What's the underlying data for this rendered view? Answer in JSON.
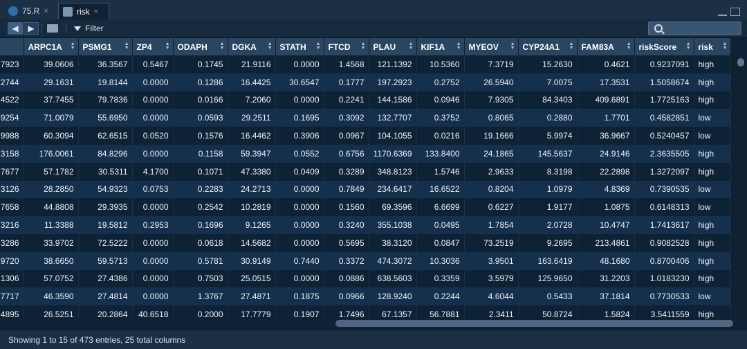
{
  "tabs": [
    {
      "label": "75.R",
      "close": "×"
    },
    {
      "label": "risk",
      "close": "×"
    }
  ],
  "toolbar": {
    "filter_label": "Filter"
  },
  "table": {
    "columns": [
      "",
      "ARPC1A",
      "PSMG1",
      "ZP4",
      "ODAPH",
      "DGKA",
      "STATH",
      "FTCD",
      "PLAU",
      "KIF1A",
      "MYEOV",
      "CYP24A1",
      "FAM83A",
      "riskScore",
      "risk"
    ],
    "rows": [
      [
        "7923",
        "39.0606",
        "36.3567",
        "0.5467",
        "0.1745",
        "21.9116",
        "0.0000",
        "1.4568",
        "121.1392",
        "10.5360",
        "7.3719",
        "15.2630",
        "0.4621",
        "0.9237091",
        "high"
      ],
      [
        "2744",
        "29.1631",
        "19.8144",
        "0.0000",
        "0.1286",
        "16.4425",
        "30.6547",
        "0.1777",
        "197.2923",
        "0.2752",
        "26.5940",
        "7.0075",
        "17.3531",
        "1.5058674",
        "high"
      ],
      [
        "4522",
        "37.7455",
        "79.7836",
        "0.0000",
        "0.0166",
        "7.2060",
        "0.0000",
        "0.2241",
        "144.1586",
        "0.0946",
        "7.9305",
        "84.3403",
        "409.6891",
        "1.7725163",
        "high"
      ],
      [
        "9254",
        "71.0079",
        "55.6950",
        "0.0000",
        "0.0593",
        "29.2511",
        "0.1695",
        "0.3092",
        "132.7707",
        "0.3752",
        "0.8065",
        "0.2880",
        "1.7701",
        "0.4582851",
        "low"
      ],
      [
        "9988",
        "60.3094",
        "62.6515",
        "0.0520",
        "0.1576",
        "16.4462",
        "0.3906",
        "0.0967",
        "104.1055",
        "0.0216",
        "19.1666",
        "5.9974",
        "36.9667",
        "0.5240457",
        "low"
      ],
      [
        "3158",
        "176.0061",
        "84.8296",
        "0.0000",
        "0.1158",
        "59.3947",
        "0.0552",
        "0.6756",
        "1170.6369",
        "133.8400",
        "24.1865",
        "145.5637",
        "24.9146",
        "2.3635505",
        "high"
      ],
      [
        "7677",
        "57.1782",
        "30.5311",
        "4.1700",
        "0.1071",
        "47.3380",
        "0.0409",
        "0.3289",
        "348.8123",
        "1.5746",
        "2.9633",
        "8.3198",
        "22.2898",
        "1.3272097",
        "high"
      ],
      [
        "3126",
        "28.2850",
        "54.9323",
        "0.0753",
        "0.2283",
        "24.2713",
        "0.0000",
        "0.7849",
        "234.6417",
        "16.6522",
        "0.8204",
        "1.0979",
        "4.8369",
        "0.7390535",
        "low"
      ],
      [
        "7658",
        "44.8808",
        "29.3935",
        "0.0000",
        "0.2542",
        "10.2819",
        "0.0000",
        "0.1560",
        "69.3596",
        "6.6699",
        "0.6227",
        "1.9177",
        "1.0875",
        "0.6148313",
        "low"
      ],
      [
        "3216",
        "11.3388",
        "19.5812",
        "0.2953",
        "0.1696",
        "9.1265",
        "0.0000",
        "0.3240",
        "355.1038",
        "0.0495",
        "1.7854",
        "2.0728",
        "10.4747",
        "1.7413617",
        "high"
      ],
      [
        "3286",
        "33.9702",
        "72.5222",
        "0.0000",
        "0.0618",
        "14.5682",
        "0.0000",
        "0.5695",
        "38.3120",
        "0.0847",
        "73.2519",
        "9.2695",
        "213.4861",
        "0.9082528",
        "high"
      ],
      [
        "9720",
        "38.6650",
        "59.5713",
        "0.0000",
        "0.5781",
        "30.9149",
        "0.7440",
        "0.3372",
        "474.3072",
        "10.3036",
        "3.9501",
        "163.6419",
        "48.1680",
        "0.8700406",
        "high"
      ],
      [
        "1306",
        "57.0752",
        "27.4386",
        "0.0000",
        "0.7503",
        "25.0515",
        "0.0000",
        "0.0886",
        "638.5603",
        "0.3359",
        "3.5979",
        "125.9650",
        "31.2203",
        "1.0183230",
        "high"
      ],
      [
        "7717",
        "46.3590",
        "27.4814",
        "0.0000",
        "1.3767",
        "27.4871",
        "0.1875",
        "0.0966",
        "128.9240",
        "0.2244",
        "4.6044",
        "0.5433",
        "37.1814",
        "0.7730533",
        "low"
      ],
      [
        "4895",
        "26.5251",
        "20.2864",
        "40.6518",
        "0.2000",
        "17.7779",
        "0.1907",
        "1.7496",
        "67.1357",
        "56.7881",
        "2.3411",
        "50.8724",
        "1.5824",
        "3.5411559",
        "high"
      ]
    ]
  },
  "status": {
    "text": "Showing 1 to 15 of 473 entries, 25 total columns"
  },
  "colors": {
    "header_bg": "#2a4560",
    "row_odd": "#0e2236",
    "row_even": "#14304c",
    "accent": "#2f6ea7"
  }
}
